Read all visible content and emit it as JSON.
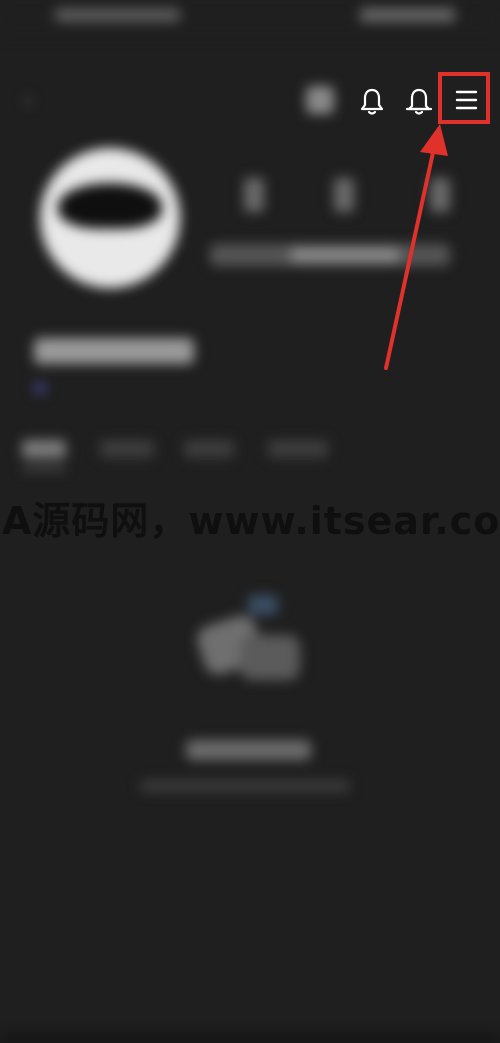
{
  "watermark": {
    "text": "A源码网，www.itsear.co"
  },
  "header": {
    "icons": [
      "notification-bell-icon",
      "notification-bell-icon",
      "menu-icon"
    ]
  },
  "colors": {
    "background": "#1f1f1f",
    "highlight_red": "#e0322b",
    "icon_white": "#ffffff"
  }
}
